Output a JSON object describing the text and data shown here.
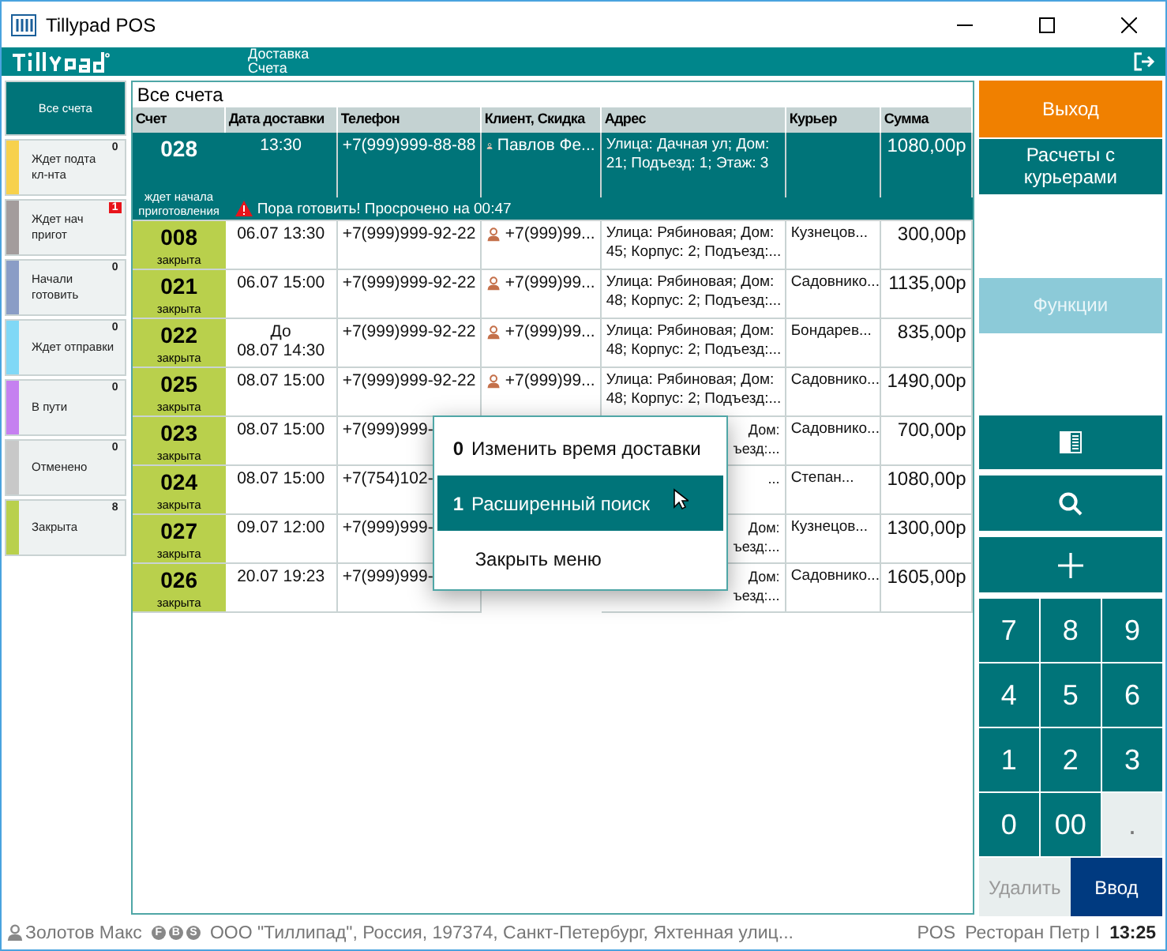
{
  "window": {
    "title": "Tillypad POS"
  },
  "header": {
    "section": "Доставка",
    "subsection": "Счета"
  },
  "sidebar": {
    "items": [
      {
        "lines": [
          "Все счета"
        ],
        "selected": true
      },
      {
        "lines": [
          "Ждет подта",
          "кл-нта"
        ],
        "count": "0",
        "alert": false,
        "color": "#f7d14c",
        "selected": false
      },
      {
        "lines": [
          "Ждет нач",
          "пригот"
        ],
        "count": "1",
        "alert": true,
        "color": "#a39c9c",
        "selected": false
      },
      {
        "lines": [
          "Начали",
          "готовить"
        ],
        "count": "0",
        "alert": false,
        "color": "#8a9dc6",
        "selected": false
      },
      {
        "lines": [
          "Ждет отправки"
        ],
        "count": "0",
        "alert": false,
        "color": "#80d8f6",
        "selected": false
      },
      {
        "lines": [
          "В пути"
        ],
        "count": "0",
        "alert": false,
        "color": "#c580f0",
        "selected": false
      },
      {
        "lines": [
          "Отменено"
        ],
        "count": "0",
        "alert": false,
        "color": "#c8c8c8",
        "selected": false
      },
      {
        "lines": [
          "Закрыта"
        ],
        "count": "8",
        "alert": false,
        "color": "#b9d04c",
        "selected": false
      }
    ]
  },
  "table": {
    "title": "Все счета",
    "columns": [
      "Счет",
      "Дата доставки",
      "Телефон",
      "Клиент, Скидка",
      "Адрес",
      "Курьер",
      "Сумма"
    ],
    "rows": [
      {
        "number": "028",
        "status": "ждет начала приготовления",
        "date": [
          "13:30"
        ],
        "phone": "+7(999)999-88-88",
        "client": "Павлов Фе...",
        "address": [
          "Улица: Дачная ул; Дом:",
          "21; Подъезд: 1; Этаж: 3"
        ],
        "sum": "1080,00р",
        "warning": "Пора готовить! Просрочено на 00:47",
        "selected": true
      },
      {
        "number": "008",
        "status": "закрыта",
        "date": [
          "06.07 13:30"
        ],
        "phone": "+7(999)999-92-22",
        "client": "+7(999)99...",
        "address": [
          "Улица: Рябиновая; Дом:",
          "45; Корпус: 2; Подъезд:..."
        ],
        "courier": "Кузнецов...",
        "sum": "300,00р",
        "selected": false
      },
      {
        "number": "021",
        "status": "закрыта",
        "date": [
          "06.07 15:00"
        ],
        "phone": "+7(999)999-92-22",
        "client": "+7(999)99...",
        "address": [
          "Улица: Рябиновая; Дом:",
          "48; Корпус: 2; Подъезд:..."
        ],
        "courier": "Садовнико...",
        "sum": "1135,00р",
        "selected": false
      },
      {
        "number": "022",
        "status": "закрыта",
        "date": [
          "До",
          "08.07 14:30"
        ],
        "phone": "+7(999)999-92-22",
        "client": "+7(999)99...",
        "address": [
          "Улица: Рябиновая; Дом:",
          "48; Корпус: 2; Подъезд:..."
        ],
        "courier": "Бондарев...",
        "sum": "835,00р",
        "selected": false
      },
      {
        "number": "025",
        "status": "закрыта",
        "date": [
          "08.07 15:00"
        ],
        "phone": "+7(999)999-92-22",
        "client": "+7(999)99...",
        "address": [
          "Улица: Рябиновая; Дом:",
          "48; Корпус: 2; Подъезд:..."
        ],
        "courier": "Садовнико...",
        "sum": "1490,00р",
        "selected": false
      },
      {
        "number": "023",
        "status": "закрыта",
        "date": [
          "08.07 15:00"
        ],
        "phone": "+7(999)999-",
        "address_tail": [
          "Дом:",
          "ъезд:..."
        ],
        "courier": "Садовнико...",
        "sum": "700,00р",
        "selected": false
      },
      {
        "number": "024",
        "status": "закрыта",
        "date": [
          "08.07 15:00"
        ],
        "phone": "+7(754)102-",
        "address_tail": [
          "..."
        ],
        "courier": "Степан...",
        "sum": "1080,00р",
        "selected": false
      },
      {
        "number": "027",
        "status": "закрыта",
        "date": [
          "09.07 12:00"
        ],
        "phone": "+7(999)999-",
        "address_tail": [
          "Дом:",
          "ъезд:..."
        ],
        "courier": "Кузнецов...",
        "sum": "1300,00р",
        "selected": false
      },
      {
        "number": "026",
        "status": "закрыта",
        "date": [
          "20.07 19:23"
        ],
        "phone": "+7(999)999-",
        "address_tail": [
          "Дом:",
          "ъезд:..."
        ],
        "courier": "Садовнико...",
        "sum": "1605,00р",
        "selected": false
      }
    ]
  },
  "menu": {
    "items": [
      {
        "key": "0",
        "label": "Изменить время доставки",
        "selected": false
      },
      {
        "key": "1",
        "label": "Расширенный поиск",
        "selected": true
      },
      {
        "label": "Закрыть меню",
        "selected": false
      }
    ]
  },
  "actions": [
    {
      "label": "Выход",
      "kind": "exit"
    },
    {
      "label": "Расчеты с курьерами",
      "kind": "primary"
    },
    {
      "label": "Функции",
      "kind": "muted"
    }
  ],
  "tools": [
    {
      "kind": "book"
    },
    {
      "kind": "search"
    },
    {
      "kind": "add"
    }
  ],
  "keypad": [
    {
      "label": "7",
      "disabled": false
    },
    {
      "label": "8",
      "disabled": false
    },
    {
      "label": "9",
      "disabled": false
    },
    {
      "label": "4",
      "disabled": false
    },
    {
      "label": "5",
      "disabled": false
    },
    {
      "label": "6",
      "disabled": false
    },
    {
      "label": "1",
      "disabled": false
    },
    {
      "label": "2",
      "disabled": false
    },
    {
      "label": "3",
      "disabled": false
    },
    {
      "label": "0",
      "disabled": false
    },
    {
      "label": "00",
      "disabled": false
    },
    {
      "label": ".",
      "disabled": true
    }
  ],
  "bottom_keys": [
    {
      "label": "Удалить",
      "disabled": true
    },
    {
      "label": "Ввод",
      "disabled": false
    }
  ],
  "status_bar": {
    "user": "Золотов Макс",
    "flags": [
      "F",
      "B",
      "S"
    ],
    "company": "ООО \"Тиллипад\", Россия, 197374, Санкт-Петербург, Яхтенная улиц...",
    "terminal": "POS",
    "restaurant": "Ресторан Петр I",
    "time": "13:25"
  }
}
